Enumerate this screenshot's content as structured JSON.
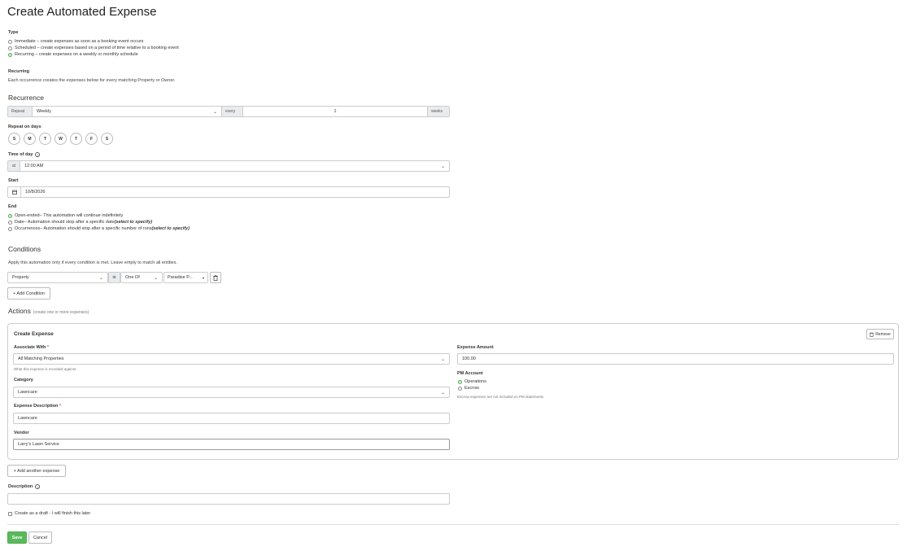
{
  "page_title": "Create Automated Expense",
  "type": {
    "label": "Type",
    "options": [
      {
        "label": "Immediate – create expenses as soon as a booking event occurs",
        "selected": false
      },
      {
        "label": "Scheduled – create expenses based on a period of time relative to a booking event",
        "selected": false
      },
      {
        "label": "Recurring – create expenses on a weekly or monthly schedule",
        "selected": true
      }
    ]
  },
  "recurring_info": {
    "label": "Recurring",
    "text": "Each occurrence creates the expenses below for every matching Property or Owner."
  },
  "recurrence": {
    "title": "Recurrence",
    "repeat_label": "Repeat",
    "repeat_value": "Weekly",
    "every_label": "every",
    "every_value": "1",
    "unit_label": "weeks",
    "days_label": "Repeat on days",
    "days": [
      "S",
      "M",
      "T",
      "W",
      "T",
      "F",
      "S"
    ],
    "time_label": "Time of day",
    "at_label": "at",
    "time_value": "12:00 AM",
    "start_label": "Start",
    "start_value": "10/8/2026",
    "end_label": "End",
    "end_options": [
      {
        "label": "Open-ended",
        "desc": " – This automation will continue indefinitely",
        "extra": "",
        "selected": true
      },
      {
        "label": "Date",
        "desc": " – Automation should stop after a specific date ",
        "extra": "(select to specify)",
        "selected": false
      },
      {
        "label": "Occurrences",
        "desc": " – Automation should stop after a specific number of runs ",
        "extra": "(select to specify)",
        "selected": false
      }
    ]
  },
  "conditions": {
    "title": "Conditions",
    "help": "Apply this automation only if every condition is met. Leave empty to match all entities.",
    "field_value": "Property",
    "is_label": "is",
    "operator_value": "One Of",
    "values_value": "Paradise P...",
    "add_label": "+ Add Condition"
  },
  "actions": {
    "title": "Actions",
    "subtitle": "(create one or more expenses)",
    "card_title": "Create Expense",
    "remove_label": "Remove",
    "associate_label": "Associate With",
    "associate_value": "All Matching Properties",
    "associate_help": "What this expense is recorded against",
    "category_label": "Category",
    "category_value": "Lawncare",
    "desc_label": "Expense Description",
    "desc_value": "Lawncare",
    "vendor_label": "Vendor",
    "vendor_value": "Larry's Lawn Service",
    "amount_label": "Expense Amount",
    "amount_value": "100.00",
    "pm_label": "PM Account",
    "pm_options": [
      {
        "label": "Operations",
        "selected": true
      },
      {
        "label": "Escrow",
        "selected": false
      }
    ],
    "pm_help": "Escrow expenses are not included on PM statements",
    "add_another_label": "+ Add another expense"
  },
  "description": {
    "label": "Description",
    "value": ""
  },
  "draft_label": "Create as a draft - I will finish this later",
  "save_label": "Save",
  "cancel_label": "Cancel",
  "colors": {
    "accent": "#5cb85c",
    "required": "#d9534f"
  }
}
